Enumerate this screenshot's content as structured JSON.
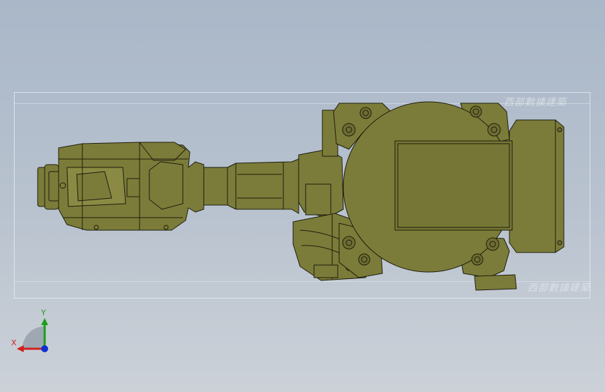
{
  "viewport": {
    "background_top": "#a9b7c8",
    "background_bottom": "#ccd1d8",
    "model_color": "#7c7c3a",
    "outline_color": "#1d1d0c"
  },
  "watermark": {
    "top_text": "西部數據建築",
    "bottom_text": "西部數據建築"
  },
  "triad": {
    "x_label": "X",
    "y_label": "Y",
    "x_color": "#d02020",
    "y_color": "#18a018",
    "z_color": "#1030d0"
  }
}
